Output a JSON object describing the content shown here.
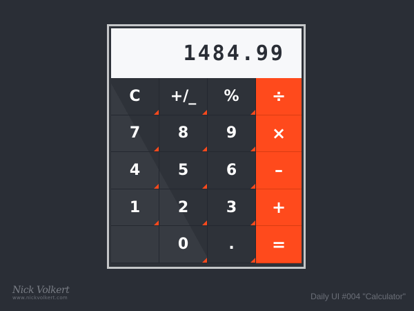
{
  "calculator": {
    "display_value": "1484.99",
    "keys": {
      "clear": "C",
      "sign": "+/_",
      "percent": "%",
      "divide": "÷",
      "seven": "7",
      "eight": "8",
      "nine": "9",
      "multiply": "×",
      "four": "4",
      "five": "5",
      "six": "6",
      "subtract": "–",
      "one": "1",
      "two": "2",
      "three": "3",
      "add": "+",
      "zero": "0",
      "decimal": ".",
      "equals": "="
    }
  },
  "footer": {
    "logo_text": "Nick Volkert",
    "logo_url": "www.nickvolkert.com",
    "caption": "Daily UI #004 \"Calculator\""
  },
  "colors": {
    "background": "#2a2e36",
    "keypad": "#2e3239",
    "accent": "#ff4a1c",
    "display": "#f7f8fa",
    "frame": "#c4c6c8"
  }
}
